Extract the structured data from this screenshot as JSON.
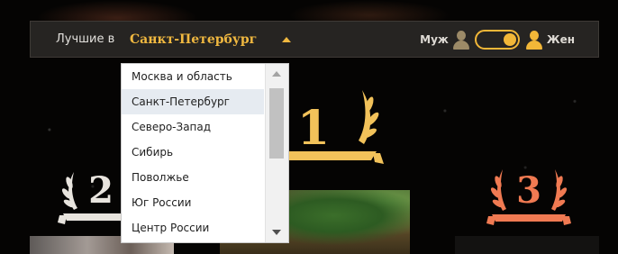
{
  "filter": {
    "best_in_label": "Лучшие в",
    "selected_city": "Санкт-Петербург"
  },
  "gender": {
    "male_label": "Муж",
    "female_label": "Жен",
    "selected": "Жен"
  },
  "ranks": [
    {
      "number": "1",
      "color": "#f2c25a"
    },
    {
      "number": "2",
      "color": "#e8e4de"
    },
    {
      "number": "3",
      "color": "#f07a52"
    }
  ],
  "dropdown": {
    "options": [
      "Москва и область",
      "Санкт-Петербург",
      "Северо-Запад",
      "Сибирь",
      "Поволжье",
      "Юг России",
      "Центр России"
    ],
    "selected_index": 1
  },
  "icons": {
    "male": "person-icon",
    "female": "person-icon",
    "caret": "chevron-up-icon"
  },
  "colors": {
    "accent": "#f2b738",
    "bar_bg": "#262422",
    "silver": "#e8e4de",
    "bronze": "#f07a52"
  }
}
